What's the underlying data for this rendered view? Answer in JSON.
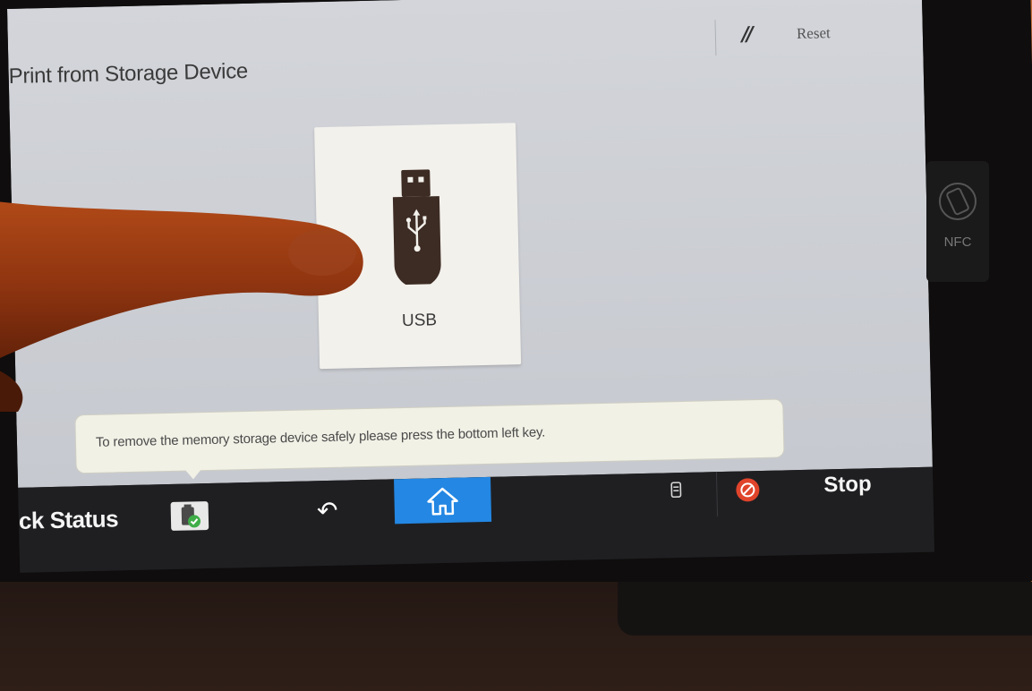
{
  "header": {
    "title": "Print from Storage Device",
    "recall_icon": "//",
    "reset_label": "Reset"
  },
  "main": {
    "usb_tile": {
      "label": "USB",
      "icon": "usb-drive-icon"
    },
    "notice": {
      "text": "To remove the memory storage device safely please press the bottom left key."
    }
  },
  "bottom_bar": {
    "status_label": "ck Status",
    "storage_status_icon": "storage-check-icon",
    "back_icon": "↶",
    "home_icon": "home-icon",
    "storage_small_icon": "storage-icon",
    "stop_label": "Stop",
    "home_color": "#2387e3",
    "stop_icon_color": "#e0442b"
  },
  "device": {
    "nfc_label": "NFC",
    "bezel_color": "#c8703a"
  }
}
